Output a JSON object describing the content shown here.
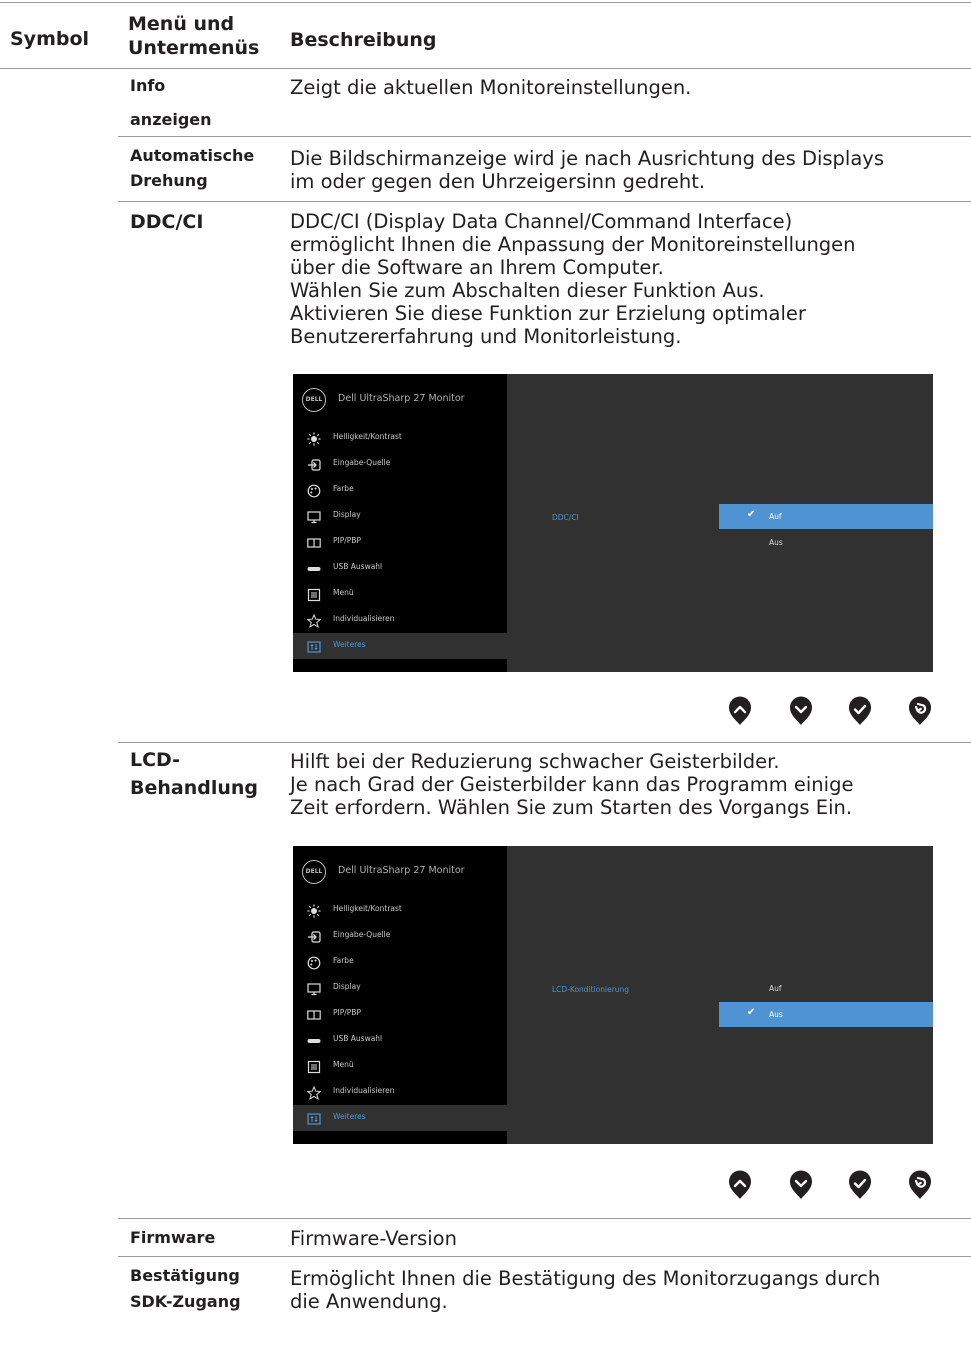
{
  "header": {
    "symbol": "Symbol",
    "menu_line1": "Menü und",
    "menu_line2": "Untermenüs",
    "description": "Beschreibung"
  },
  "rows": {
    "info": {
      "menu_line1": "Info",
      "menu_line2": "anzeigen",
      "description": "Zeigt die aktuellen Monitoreinstellungen."
    },
    "rotation": {
      "menu_line1": "Automatische",
      "menu_line2": "Drehung",
      "description": "Die Bildschirmanzeige wird je nach Ausrichtung des Displays\nim oder gegen den Uhrzeigersinn gedreht."
    },
    "ddcci": {
      "menu": "DDC/CI",
      "description": "DDC/CI (Display Data Channel/Command Interface)\nermöglicht Ihnen die Anpassung der Monitoreinstellungen\nüber die Software an Ihrem Computer.\nWählen Sie zum Abschalten dieser Funktion Aus.\nAktivieren Sie diese Funktion zur Erzielung optimaler\nBenutzererfahrung und Monitorleistung."
    },
    "lcd": {
      "menu_line1": "LCD-",
      "menu_line2": "Behandlung",
      "description": "Hilft bei der Reduzierung schwacher Geisterbilder.\nJe nach Grad der Geisterbilder kann das Programm einige\nZeit erfordern. Wählen Sie zum Starten des Vorgangs Ein."
    },
    "firmware": {
      "menu": "Firmware",
      "description": "Firmware-Version"
    },
    "sdk": {
      "menu_line1": "Bestätigung",
      "menu_line2": "SDK-Zugang",
      "description": "Ermöglicht Ihnen die Bestätigung des Monitorzugangs durch\ndie Anwendung."
    }
  },
  "osd": {
    "logo": "DELL",
    "model": "Dell UltraSharp 27 Monitor",
    "menu_items": [
      {
        "label": "Helligkeit/Kontrast",
        "icon": "brightness-icon"
      },
      {
        "label": "Eingabe-Quelle",
        "icon": "input-source-icon"
      },
      {
        "label": "Farbe",
        "icon": "color-palette-icon"
      },
      {
        "label": "Display",
        "icon": "display-icon"
      },
      {
        "label": "PIP/PBP",
        "icon": "pip-pbp-icon"
      },
      {
        "label": "USB Auswahl",
        "icon": "usb-icon"
      },
      {
        "label": "Menü",
        "icon": "menu-icon"
      },
      {
        "label": "Individualisieren",
        "icon": "star-icon"
      },
      {
        "label": "Weiteres",
        "icon": "others-icon"
      }
    ],
    "active_item": "Weiteres",
    "osd1": {
      "parameter": "DDC/CI",
      "options": [
        "Auf",
        "Aus"
      ],
      "selected": "Auf"
    },
    "osd2": {
      "parameter": "LCD-Konditionierung",
      "options": [
        "Auf",
        "Aus"
      ],
      "selected": "Aus"
    }
  },
  "buttons": [
    "up-button",
    "down-button",
    "ok-button",
    "back-button"
  ],
  "colors": {
    "osd_sidebar": "#000000",
    "osd_panel": "#313131",
    "accent": "#4f93d2",
    "button": "#231f20"
  }
}
